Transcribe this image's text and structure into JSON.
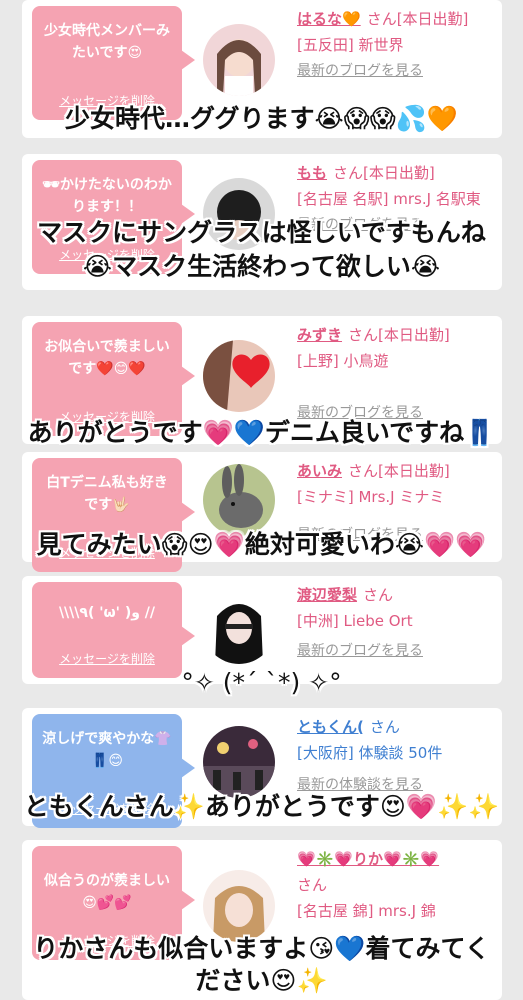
{
  "entries": [
    {
      "message": "少女時代メンバーみたいです😍",
      "delete_label": "メッセージを削除",
      "name": "はるな🧡",
      "suffix": "さん[本日出勤]",
      "location": "[五反田] 新世界",
      "blog_link": "最新のブログを見る",
      "overlay": "少女時代…ググります😭😱😱💦🧡"
    },
    {
      "message": "🕶かけたないのわかります！！",
      "delete_label": "メッセージを削除",
      "name": "もも",
      "suffix": "さん[本日出勤]",
      "location": "[名古屋 名駅] mrs.J 名駅東",
      "blog_link": "最新のブログを見る",
      "overlay": "マスクにサングラスは怪しいですもんね",
      "overlay2": "😭マスク生活終わって欲しい😭"
    },
    {
      "message": "お似合いで羨ましいです❤️😊❤️",
      "delete_label": "メッセージを削除",
      "name": "みずき",
      "suffix": "さん[本日出勤]",
      "location": "[上野] 小鳥遊",
      "blog_link": "最新のブログを見る",
      "overlay": "ありがとうです💗💙デニム良いですね👖"
    },
    {
      "message": "白Tデニム私も好きです🤟🏻",
      "delete_label": "メッセージを削除",
      "name": "あいみ",
      "suffix": "さん[本日出勤]",
      "location": "[ミナミ] Mrs.J ミナミ",
      "blog_link": "最新のブログを見る",
      "overlay": "見てみたい😱😍💗絶対可愛いわ😭💗💗"
    },
    {
      "message": "\\\\\\\\٩( 'ω' )و //",
      "delete_label": "メッセージを削除",
      "name": "渡辺愛梨",
      "suffix": "さん",
      "location": "[中洲] Liebe Ort",
      "blog_link": "最新のブログを見る",
      "overlay": "°✧ (*´ `*) ✧°"
    },
    {
      "message": "涼しげで爽やかな👚👖😊",
      "delete_label": "メッセージを削除",
      "name": "ともくん(",
      "suffix": "さん",
      "location": "[大阪府] 体験談 50件",
      "blog_link": "最新の体験談を見る",
      "overlay": "ともくんさん✨ありがとうです😍💗✨✨"
    },
    {
      "message": "似合うのが羨ましい😍💕💕",
      "delete_label": "メッセージを削除",
      "name": "💗✳️💗りか💗✳️💗",
      "suffix": "さん",
      "location": "[名古屋 錦] mrs.J 錦",
      "blog_link": "",
      "overlay": "りかさんも似合いますよ😘💙着てみてく",
      "overlay2": "ださい😍✨"
    }
  ],
  "colors": {
    "accent_pink": "#e05a82",
    "bubble_pink": "#f5a3b2",
    "bubble_blue": "#8fb5ec",
    "accent_blue": "#3f7fd1"
  }
}
